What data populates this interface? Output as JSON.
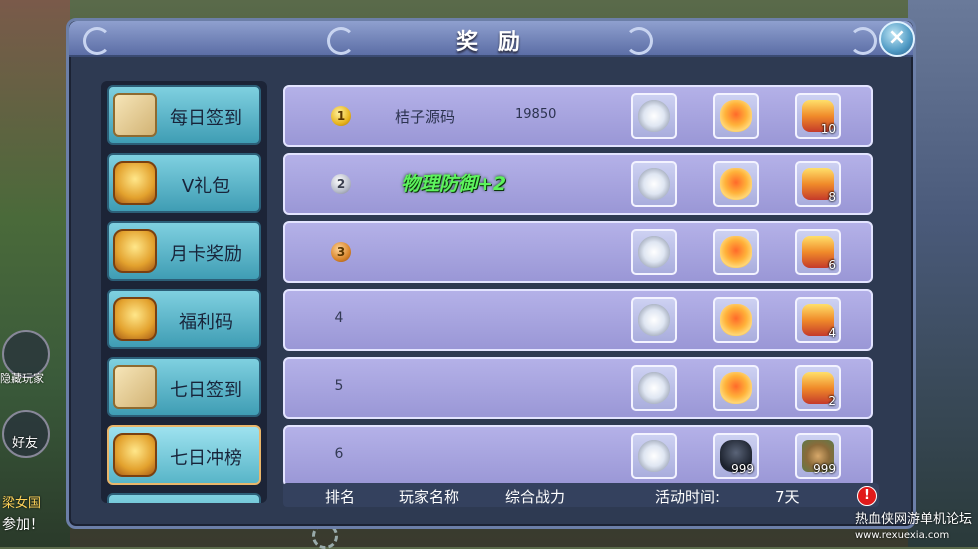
{
  "dialog": {
    "title": "奖 励"
  },
  "menu": [
    {
      "label": "每日签到",
      "icon": "scroll-icon"
    },
    {
      "label": "V礼包",
      "icon": "treasure-chest-icon"
    },
    {
      "label": "月卡奖励",
      "icon": "treasure-chest-icon"
    },
    {
      "label": "福利码",
      "icon": "treasure-chest-icon"
    },
    {
      "label": "七日签到",
      "icon": "scroll-icon"
    },
    {
      "label": "七日冲榜",
      "icon": "treasure-chest-icon",
      "active": true
    }
  ],
  "rows": [
    {
      "rank": "1",
      "name": "桔子源码",
      "power": "19850",
      "rewards": [
        {
          "icon": "silver-ingot-icon"
        },
        {
          "icon": "orange-scroll-icon"
        },
        {
          "icon": "chest-icon",
          "qty": "10"
        }
      ]
    },
    {
      "rank": "2",
      "name": "",
      "power": "",
      "rewards": [
        {
          "icon": "silver-ingot-icon"
        },
        {
          "icon": "orange-scroll-icon"
        },
        {
          "icon": "chest-icon",
          "qty": "8"
        }
      ]
    },
    {
      "rank": "3",
      "name": "",
      "power": "",
      "rewards": [
        {
          "icon": "silver-ingot-icon"
        },
        {
          "icon": "orange-scroll-icon"
        },
        {
          "icon": "chest-icon",
          "qty": "6"
        }
      ]
    },
    {
      "rank": "4",
      "name": "",
      "power": "",
      "rewards": [
        {
          "icon": "silver-ingot-icon"
        },
        {
          "icon": "orange-scroll-icon"
        },
        {
          "icon": "chest-icon",
          "qty": "4"
        }
      ]
    },
    {
      "rank": "5",
      "name": "",
      "power": "",
      "rewards": [
        {
          "icon": "silver-ingot-icon"
        },
        {
          "icon": "orange-scroll-icon"
        },
        {
          "icon": "chest-icon",
          "qty": "2"
        }
      ]
    },
    {
      "rank": "6",
      "name": "",
      "power": "",
      "rewards": [
        {
          "icon": "silver-ingot-icon"
        },
        {
          "icon": "helmet-icon",
          "qty": "999"
        },
        {
          "icon": "herb-icon",
          "qty": "999"
        }
      ]
    }
  ],
  "buff_popup": "物理防御+2",
  "footer": {
    "rank": "排名",
    "player": "玩家名称",
    "power": "综合战力",
    "time_label": "活动时间:",
    "time_value": "7天",
    "info": "!"
  },
  "side": {
    "hide_players": "隐藏玩家",
    "friend": "好友",
    "chat_prefix": "梁女国",
    "join": "参加！"
  },
  "watermark": {
    "line1": "热血侠网游单机论坛",
    "line2": "www.rexuexia.com"
  },
  "colors": {
    "dialog_bg": "#2e3a52",
    "row_bg": "#a9a6e0",
    "menu_item": "#5bb6cb",
    "buff_text": "#5df25d",
    "alert": "#e11a1a"
  }
}
